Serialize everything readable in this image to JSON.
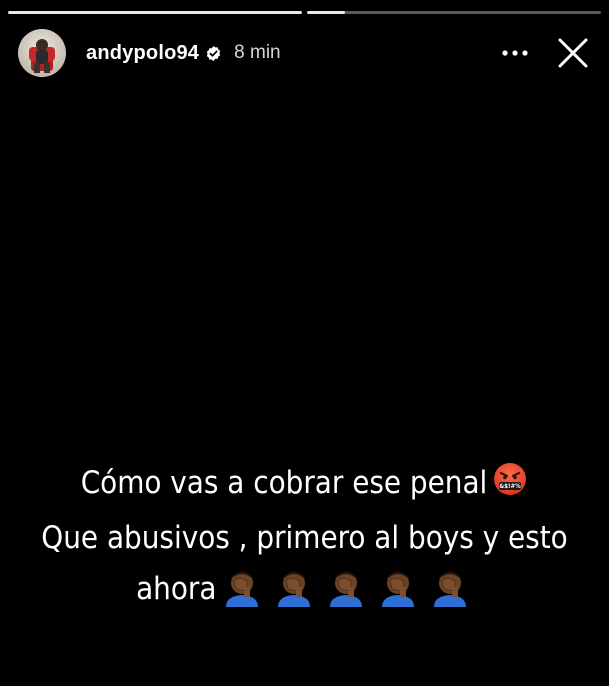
{
  "story": {
    "progress": [
      1.0,
      0.13
    ],
    "user": {
      "username": "andypolo94",
      "verified": true,
      "time": "8 min",
      "avatar_icon": "avatar-photo"
    },
    "actions": {
      "more_icon": "ellipsis-icon",
      "close_icon": "close-icon"
    },
    "caption": {
      "line1": "Cómo vas a cobrar ese penal",
      "line1_emoji": "face-with-symbols-on-mouth",
      "line2": "Que abusivos , primero al boys y esto",
      "line3": "ahora",
      "line3_emoji": "man-facepalming-dark-skin",
      "line3_emoji_count": 5,
      "symbols_text": "&$!#%"
    },
    "colors": {
      "background": "#000000",
      "text": "#ffffff",
      "verified_blue": "#ffffff",
      "emoji_red": "#e8402b",
      "facepalm_skin": "#6b4226",
      "facepalm_shirt": "#2e6fd6"
    }
  }
}
